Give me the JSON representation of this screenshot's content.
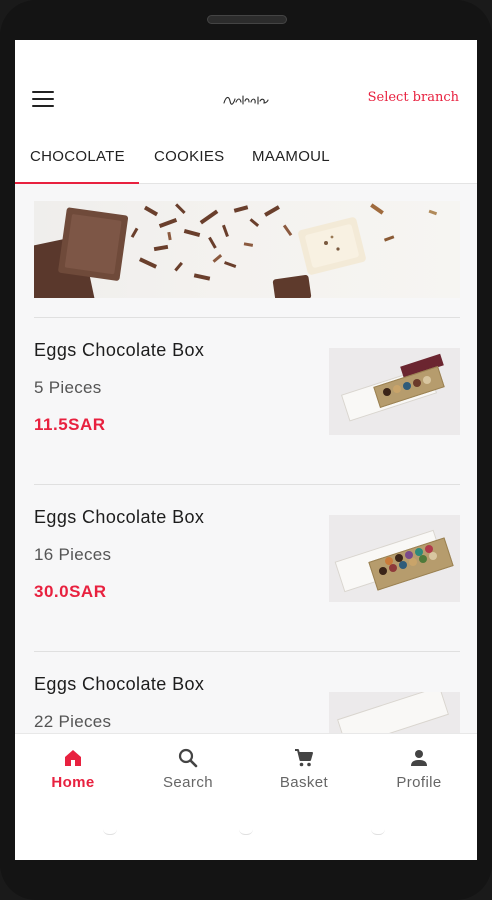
{
  "header": {
    "logo_text": "Patchi",
    "branch_label": "Select branch"
  },
  "tabs": [
    {
      "label": "CHOCOLATE",
      "active": true
    },
    {
      "label": "COOKIES",
      "active": false
    },
    {
      "label": "MAAMOUL",
      "active": false
    }
  ],
  "products": [
    {
      "name": "Eggs Chocolate Box",
      "quantity": "5 Pieces",
      "price": "11.5SAR"
    },
    {
      "name": "Eggs Chocolate Box",
      "quantity": "16 Pieces",
      "price": "30.0SAR"
    },
    {
      "name": "Eggs Chocolate Box",
      "quantity": "22 Pieces",
      "price": ""
    }
  ],
  "bottom_nav": [
    {
      "label": "Home",
      "icon": "home-icon",
      "active": true
    },
    {
      "label": "Search",
      "icon": "search-icon",
      "active": false
    },
    {
      "label": "Basket",
      "icon": "cart-icon",
      "active": false
    },
    {
      "label": "Profile",
      "icon": "person-icon",
      "active": false
    }
  ],
  "colors": {
    "accent": "#e8213f",
    "background": "#f7f7f8",
    "text": "#1d1d1d"
  }
}
